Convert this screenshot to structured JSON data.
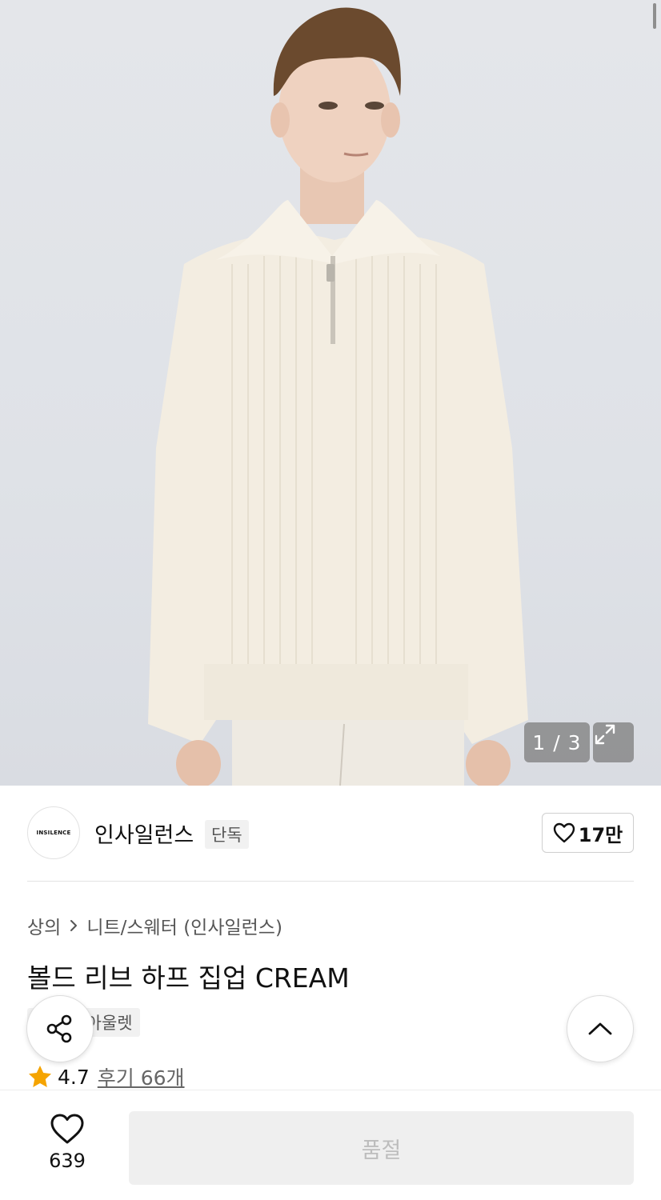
{
  "gallery": {
    "counter": "1 / 3",
    "expand_icon": "expand-icon",
    "current_index": 1,
    "total": 3
  },
  "brand": {
    "logo_text": "INSILENCE",
    "name": "인사일런스",
    "exclusive_tag": "단독",
    "likes": "17만"
  },
  "breadcrumb": {
    "category": "상의",
    "subcategory": "니트/스웨터 (인사일런스)"
  },
  "product": {
    "title": "볼드 리브 하프 집업 CREAM",
    "tags": [
      "단독",
      "아울렛"
    ],
    "rating": "4.7",
    "reviews": "후기 66개"
  },
  "bottom": {
    "wish_count": "639",
    "sold_out_label": "품절"
  },
  "colors": {
    "star": "#f5a400",
    "disabled_button_bg": "#efefef",
    "disabled_button_text": "#bdbdbd"
  }
}
